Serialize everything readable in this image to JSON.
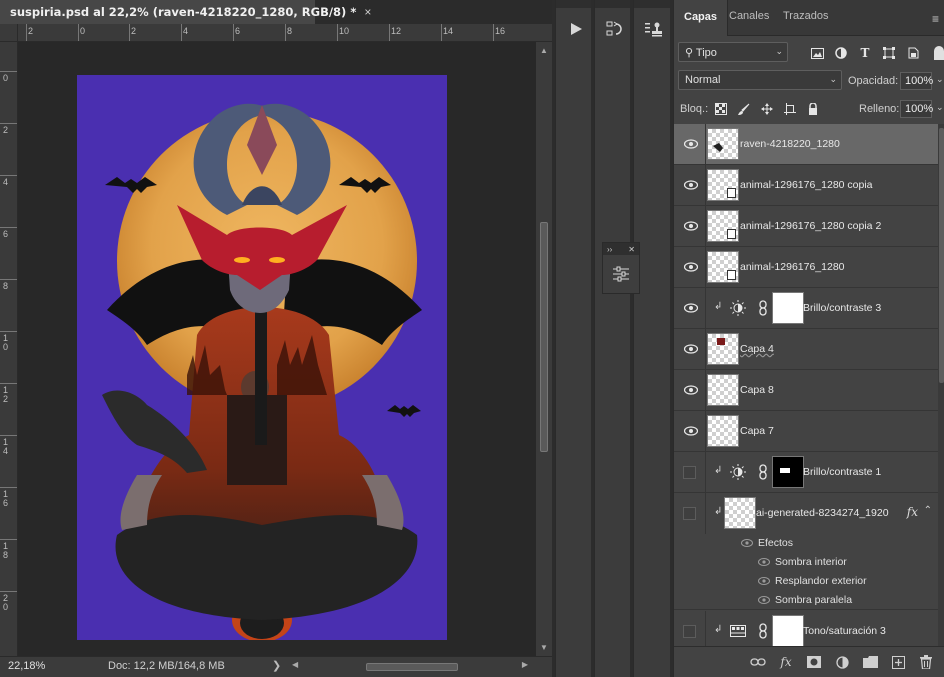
{
  "document": {
    "tab_title": "suspiria.psd al 22,2% (raven-4218220_1280, RGB/8) *",
    "close_glyph": "×"
  },
  "ruler_h": [
    "2",
    "0",
    "2",
    "4",
    "6",
    "8",
    "10",
    "12",
    "14",
    "16"
  ],
  "ruler_v": [
    "0",
    "2",
    "4",
    "6",
    "8",
    "1\n0",
    "1\n2",
    "1\n4",
    "1\n6",
    "1\n8",
    "2\n0",
    "2\n2"
  ],
  "status": {
    "zoom": "22,18%",
    "doc_info": "Doc: 12,2 MB/164,8 MB",
    "arrow": "❯"
  },
  "layers_panel": {
    "tabs": [
      "Capas",
      "Canales",
      "Trazados"
    ],
    "filter_kind": "Tipo",
    "blend_mode": "Normal",
    "opacity_label": "Opacidad:",
    "opacity_value": "100%",
    "lock_label": "Bloq.:",
    "fill_label": "Relleno:",
    "fill_value": "100%",
    "layers": [
      {
        "name": "raven-4218220_1280",
        "visible": true,
        "selected": true
      },
      {
        "name": "animal-1296176_1280 copia",
        "visible": true
      },
      {
        "name": "animal-1296176_1280 copia 2",
        "visible": true
      },
      {
        "name": "animal-1296176_1280",
        "visible": true
      },
      {
        "name": "Brillo/contraste 3",
        "visible": true
      },
      {
        "name": "Capa 4",
        "visible": true
      },
      {
        "name": "Capa 8",
        "visible": true
      },
      {
        "name": "Capa 7",
        "visible": true
      },
      {
        "name": "Brillo/contraste 1",
        "visible": false
      },
      {
        "name": "ai-generated-8234274_1920",
        "visible": false
      },
      {
        "name": "Tono/saturación 3",
        "visible": false
      }
    ],
    "effects": {
      "header": "Efectos",
      "items": [
        "Sombra interior",
        "Resplandor exterior",
        "Sombra paralela"
      ]
    },
    "fx_label": "fx"
  },
  "colors": {
    "canvas_bg": "#4a2fb0",
    "moon": "#e2a24a",
    "selected_row": "#686868"
  }
}
